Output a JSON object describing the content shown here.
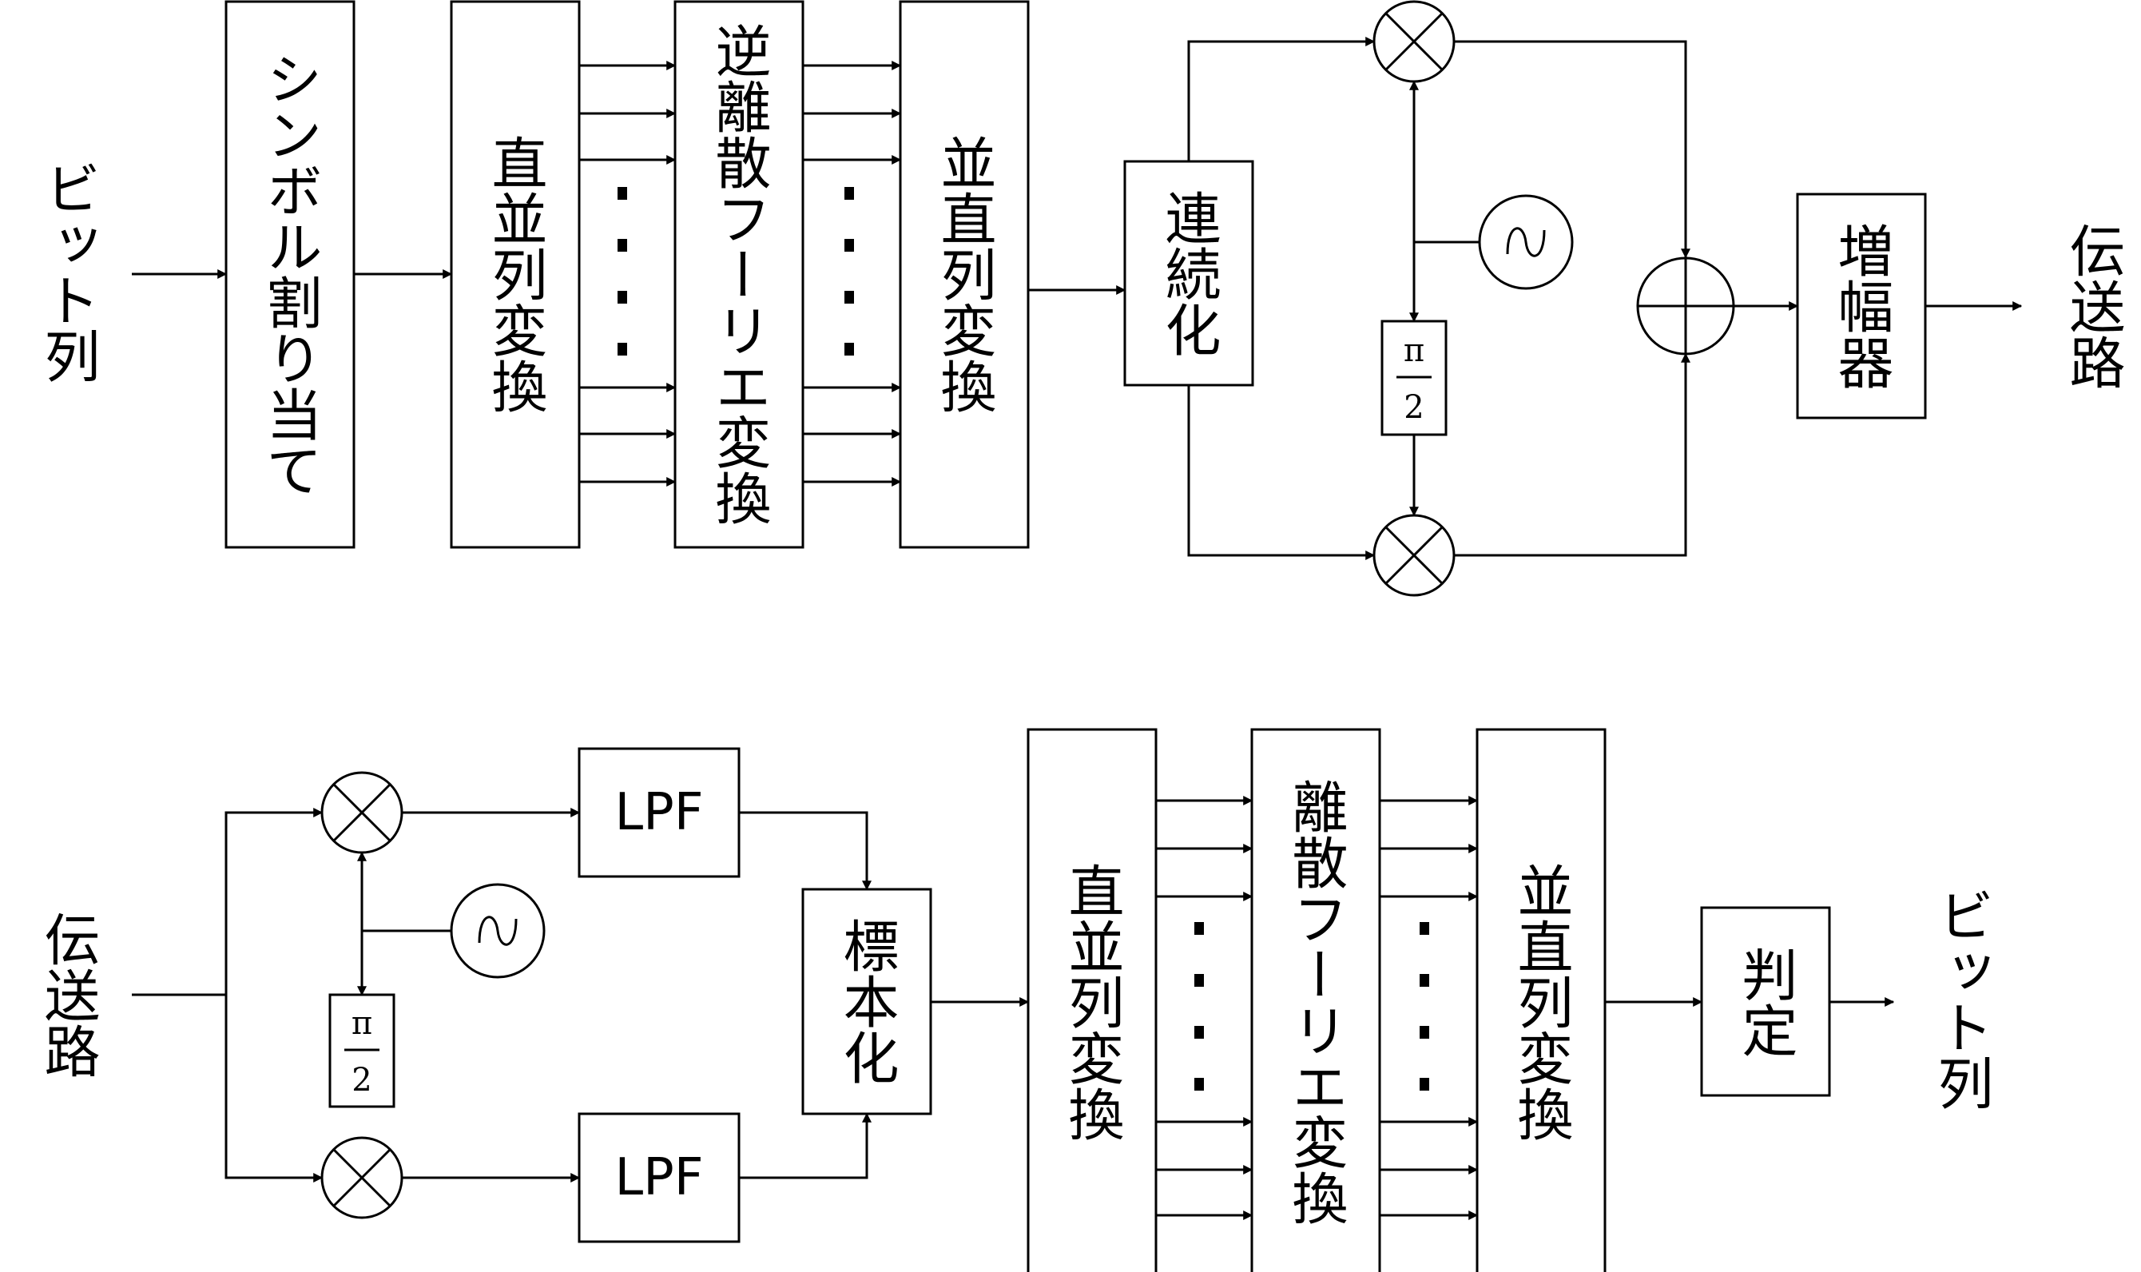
{
  "tx": {
    "input_label": "ビット列",
    "output_label": "伝送路",
    "symbol_mapping": "シンボル割り当て",
    "sp_conversion": "直並列変換",
    "idft": "逆離散フーリエ変換",
    "ps_conversion": "並直列変換",
    "serialize": "連続化",
    "amplifier": "増幅器",
    "phase_num": "π",
    "phase_den": "2"
  },
  "rx": {
    "input_label": "伝送路",
    "output_label": "ビット列",
    "lpf_upper": "LPF",
    "lpf_lower": "LPF",
    "sampling": "標本化",
    "sp_conversion": "直並列変換",
    "dft": "離散フーリエ変換",
    "ps_conversion": "並直列変換",
    "decision": "判定",
    "phase_num": "π",
    "phase_den": "2"
  },
  "colors": {
    "stroke": "#000000",
    "background": "#ffffff"
  }
}
